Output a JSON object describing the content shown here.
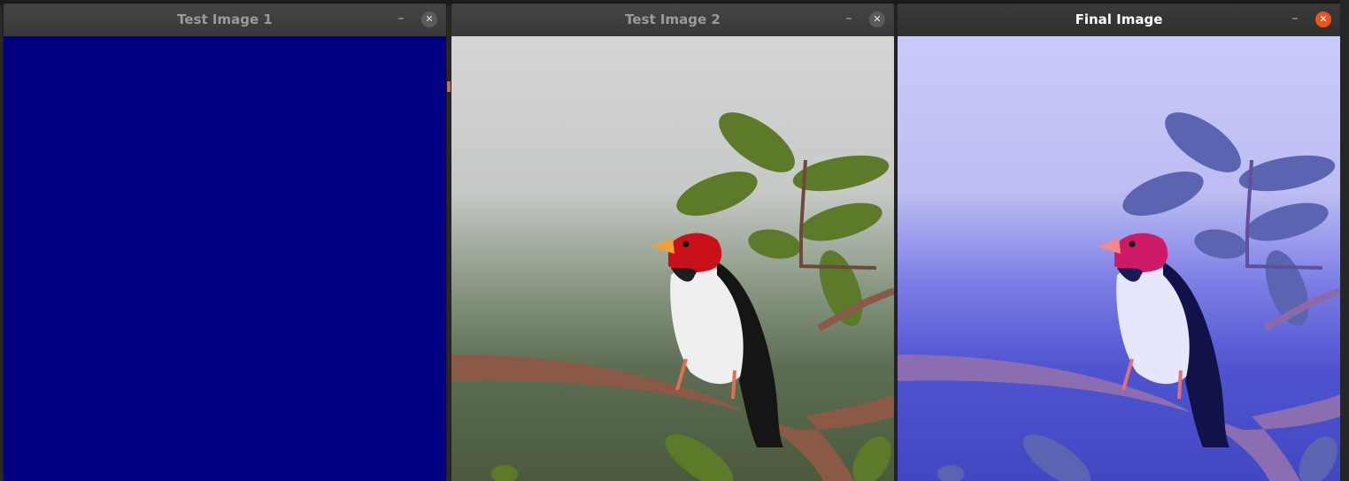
{
  "windows": [
    {
      "title": "Test Image 1",
      "content": "solid",
      "fill_color": "#000080",
      "close_icon": "close-icon",
      "minimize_icon": "minimize-icon"
    },
    {
      "title": "Test Image 2",
      "content": "photo-bird",
      "close_icon": "close-icon",
      "minimize_icon": "minimize-icon"
    },
    {
      "title": "Final Image",
      "content": "photo-bird-blended",
      "tint_color": "#8080ff",
      "close_icon": "close-icon",
      "minimize_icon": "minimize-icon",
      "active": true
    }
  ],
  "colors": {
    "titlebar": "#3c3c3c",
    "active_close": "#e95420",
    "bird_head": "#c8101a",
    "branch": "#8a5a46",
    "leaves": "#5d7a2a"
  }
}
